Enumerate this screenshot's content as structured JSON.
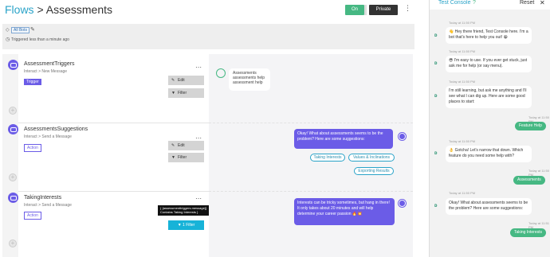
{
  "header": {
    "breadcrumb_root": "Flows",
    "breadcrumb_sep": " > ",
    "page_title": "Assessments",
    "on_label": "On",
    "private_label": "Private",
    "menu_glyph": "⋮"
  },
  "info": {
    "tag": "All Bots",
    "triggered": "Triggered less than a minute ago"
  },
  "steps": [
    {
      "name": "AssessmentTriggers",
      "sub": "Interact > New Message",
      "badge": "Trigger",
      "edit": "Edit",
      "filter": "Filter"
    },
    {
      "name": "AssessmentsSuggestions",
      "sub": "Interact > Send a Message",
      "badge": "Action",
      "edit": "Edit",
      "filter": "Filter"
    },
    {
      "name": "TakingInterests",
      "sub": "Interact > Send a Message",
      "badge": "Action",
      "filter": "1 Filter",
      "tooltip": "{ {assessmenttriggers.message}} Contains Taking Interests }"
    }
  ],
  "preview": {
    "trigger_bubble": "Assessments assessments help assessment help",
    "suggestion_bubble": "Okay! What about assessments seems to be the problem? Here are some suggestions:",
    "quick_replies": [
      "Taking Interests",
      "Values & Inclinations",
      "Exporting Results"
    ],
    "interests_bubble": "Interests can be tricky sometimes, but hang in there! It only takes about 20 minutes and will help determine your career passion 🔥💥"
  },
  "console": {
    "title": "Test Console",
    "help_icon": "question-circle-icon",
    "reset": "Reset",
    "close": "✕",
    "messages": [
      {
        "from": "bot",
        "time": "Today at 11:50 PM",
        "text": "👋 Hey there friend, Test Console here. I'm a bot that's here to help you out! 😀"
      },
      {
        "from": "bot",
        "time": "Today at 11:50 PM",
        "text": "😎 I'm easy to use. If you ever get stuck, just ask me for help (or say menu)."
      },
      {
        "from": "bot",
        "time": "Today at 11:50 PM",
        "text": "I'm still learning, but ask me anything and I'll see what I can dig up. Here are some good places to start:"
      },
      {
        "from": "user",
        "time": "Today at 11:50 PM",
        "text": "Feature Help"
      },
      {
        "from": "bot",
        "time": "Today at 11:50 PM",
        "text": "👌 Gotcha! Let's narrow that down. Which feature do you need some help with?"
      },
      {
        "from": "user",
        "time": "Today at 11:50 PM",
        "text": "Assessments"
      },
      {
        "from": "bot",
        "time": "Today at 11:50 PM",
        "text": "Okay! What about assessments seems to be the problem? Here are some suggestions:"
      },
      {
        "from": "user",
        "time": "Today at 11:51 PM",
        "text": "Taking Interests"
      }
    ]
  },
  "colors": {
    "accent": "#2aa3c8",
    "purple": "#6b5ce7",
    "green": "#46b883"
  }
}
